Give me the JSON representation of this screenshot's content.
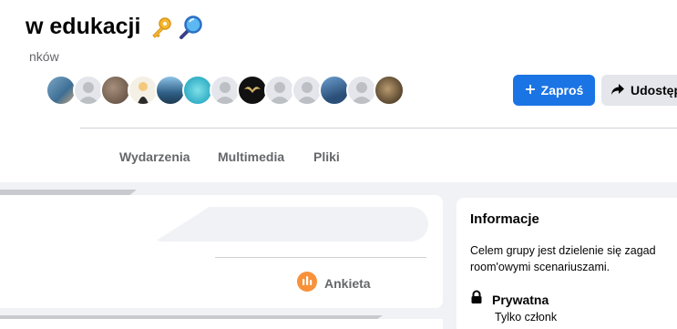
{
  "group": {
    "title": "w edukacji",
    "members_label": "nków"
  },
  "actions": {
    "invite_label": "Zaproś",
    "share_label": "Udostęp"
  },
  "tabs": [
    {
      "label": "Wydarzenia"
    },
    {
      "label": "Multimedia"
    },
    {
      "label": "Pliki"
    }
  ],
  "composer": {
    "poll_label": "Ankieta"
  },
  "about": {
    "title": "Informacje",
    "description": "Celem grupy jest dzielenie się zagad room'owymi scenariuszami.",
    "privacy_title": "Prywatna",
    "privacy_sub": "Tylko członk"
  },
  "colors": {
    "accent": "#1b74e4",
    "poll_icon": "#f7923a",
    "text_secondary": "#65676b",
    "background": "#f0f2f5"
  }
}
